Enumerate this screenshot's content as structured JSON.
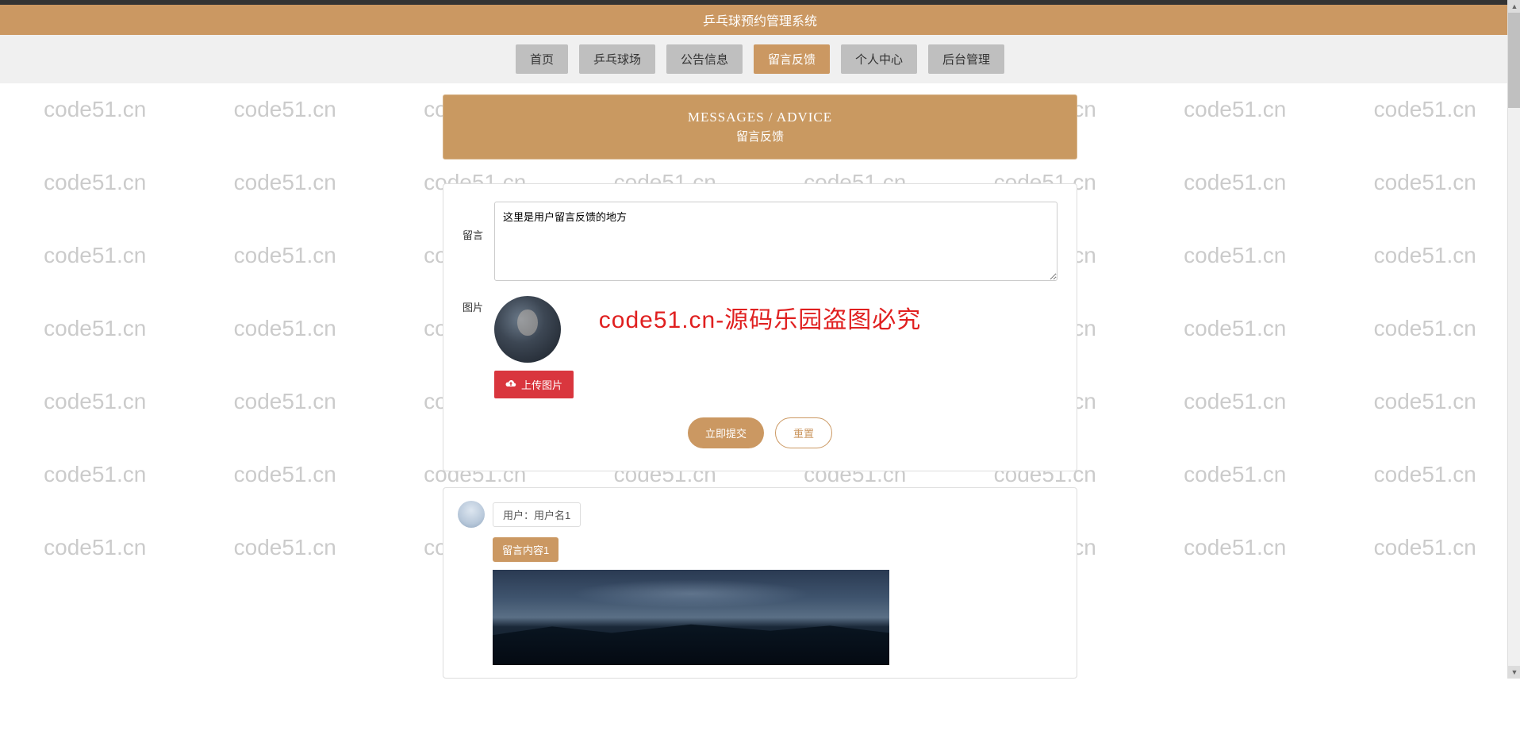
{
  "header": {
    "title": "乒乓球预约管理系统"
  },
  "nav": {
    "items": [
      {
        "label": "首页",
        "active": false
      },
      {
        "label": "乒乓球场",
        "active": false
      },
      {
        "label": "公告信息",
        "active": false
      },
      {
        "label": "留言反馈",
        "active": true
      },
      {
        "label": "个人中心",
        "active": false
      },
      {
        "label": "后台管理",
        "active": false
      }
    ]
  },
  "banner": {
    "title_en": "MESSAGES / ADVICE",
    "title_cn": "留言反馈"
  },
  "form": {
    "message_label": "留言",
    "message_value": "这里是用户留言反馈的地方",
    "image_label": "图片",
    "upload_label": "上传图片",
    "submit_label": "立即提交",
    "reset_label": "重置"
  },
  "comment": {
    "user_label": "用户：用户名1",
    "content_tag": "留言内容1"
  },
  "watermark": {
    "text": "code51.cn",
    "big_text": "code51.cn-源码乐园盗图必究"
  },
  "colors": {
    "primary": "#cb9862",
    "danger": "#d9363e",
    "nav_inactive": "#bfbfbf"
  }
}
